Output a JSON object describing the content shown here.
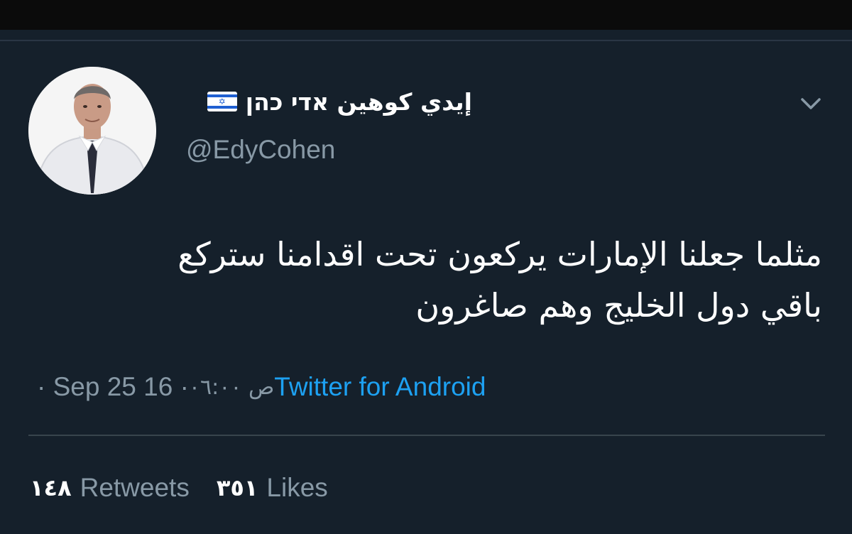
{
  "tweet": {
    "display_name": "إيدي كوهين אדי כהן",
    "flag_icon": "israel-flag-icon",
    "handle": "@EdyCohen",
    "text_line1": "مثلما جعلنا الإمارات يركعون تحت اقدامنا ستركع",
    "text_line2": "باقي دول الخليج وهم صاغرون",
    "date": "· Sep 25 16 ·",
    "time": "ص ٠٦:٠٠",
    "source": "Twitter for Android",
    "retweets_count": "١٤٨",
    "retweets_label": "Retweets",
    "likes_count": "٣٥١",
    "likes_label": "Likes",
    "menu_icon": "chevron-down-icon",
    "colors": {
      "background": "#15202b",
      "text": "#ffffff",
      "muted": "#8899a6",
      "accent": "#1da1f2",
      "divider": "#38444d"
    }
  }
}
